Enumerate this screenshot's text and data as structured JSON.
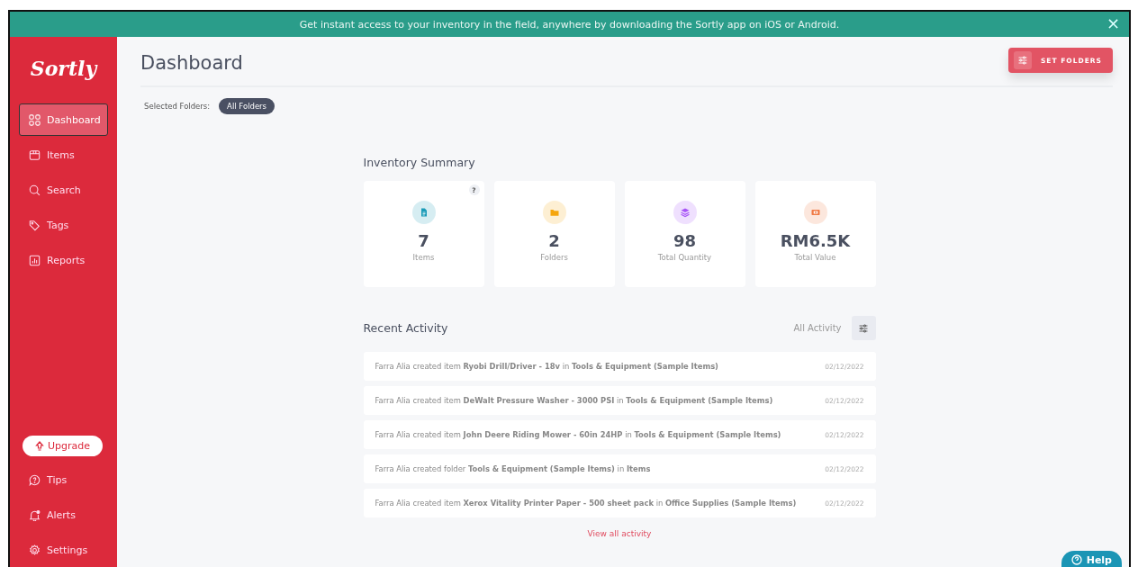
{
  "banner": {
    "text": "Get instant access to your inventory in the field, anywhere by downloading the Sortly app on iOS or Android.",
    "close": "×"
  },
  "sidebar": {
    "logo": "Sortly",
    "items": [
      {
        "label": "Dashboard",
        "selected": true
      },
      {
        "label": "Items",
        "selected": false
      },
      {
        "label": "Search",
        "selected": false
      },
      {
        "label": "Tags",
        "selected": false
      },
      {
        "label": "Reports",
        "selected": false
      }
    ],
    "upgrade": "Upgrade",
    "bottom_items": [
      {
        "label": "Tips",
        "selected": false
      },
      {
        "label": "Alerts",
        "selected": false
      },
      {
        "label": "Settings",
        "selected": false
      }
    ]
  },
  "header": {
    "title": "Dashboard",
    "button": "SET FOLDERS"
  },
  "selected_folders": {
    "label": "Selected Folders:",
    "chip": "All Folders"
  },
  "inventory_summary": {
    "title": "Inventory Summary",
    "help": "?",
    "cards": [
      {
        "value": "7",
        "label": "Items",
        "color": "#1a9bb8"
      },
      {
        "value": "2",
        "label": "Folders",
        "color": "#f5a50c"
      },
      {
        "value": "98",
        "label": "Total Quantity",
        "color": "#a855f7"
      },
      {
        "value": "RM6.5K",
        "label": "Total Value",
        "color": "#f07a45"
      }
    ]
  },
  "recent_activity": {
    "title": "Recent Activity",
    "filter": "All Activity",
    "rows": [
      {
        "text": "Farra Alia created item **Ryobi Drill/Driver - 18v** in **Tools & Equipment (Sample Items)**",
        "date": "02/12/2022"
      },
      {
        "text": "Farra Alia created item **DeWalt Pressure Washer - 3000 PSI** in **Tools & Equipment (Sample Items)**",
        "date": "02/12/2022"
      },
      {
        "text": "Farra Alia created item **John Deere Riding Mower - 60in 24HP** in **Tools & Equipment (Sample Items)**",
        "date": "02/12/2022"
      },
      {
        "text": "Farra Alia created folder **Tools & Equipment (Sample Items)** in **Items**",
        "date": "02/12/2022"
      },
      {
        "text": "Farra Alia created item **Xerox Vitality Printer Paper - 500 sheet pack** in **Office Supplies (Sample Items)**",
        "date": "02/12/2022"
      }
    ],
    "link": "View all activity"
  },
  "help_button": "Help"
}
